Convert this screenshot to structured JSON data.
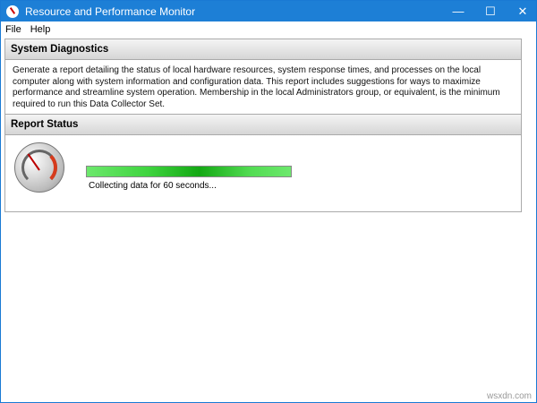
{
  "window": {
    "title": "Resource and Performance Monitor",
    "minimize": "—",
    "maximize": "☐",
    "close": "✕"
  },
  "menu": [
    "File",
    "Help"
  ],
  "diagnostics": {
    "heading": "System Diagnostics",
    "description": "Generate a report detailing the status of local hardware resources, system response times, and processes on the local computer along with system information and configuration data. This report includes suggestions for ways to maximize performance and streamline system operation. Membership in the local Administrators group, or equivalent, is the minimum required to run this Data Collector Set."
  },
  "report": {
    "heading": "Report Status",
    "progress_percent": 100,
    "status_text": "Collecting data for 60 seconds..."
  },
  "watermark": "wsxdn.com"
}
